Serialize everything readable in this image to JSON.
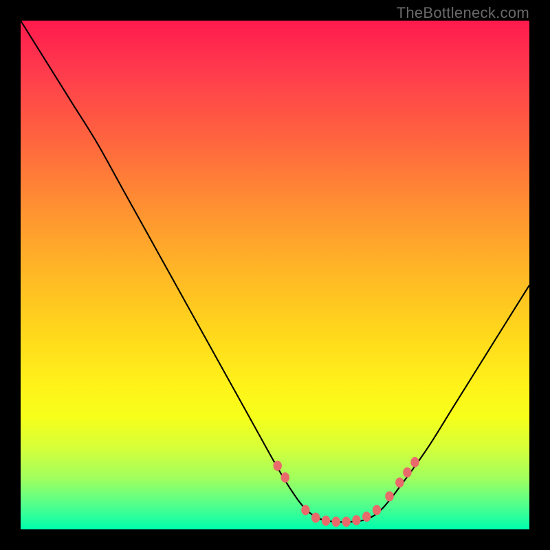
{
  "watermark": "TheBottleneck.com",
  "chart_data": {
    "type": "line",
    "title": "",
    "xlabel": "",
    "ylabel": "",
    "xlim": [
      0,
      100
    ],
    "ylim": [
      0,
      100
    ],
    "series": [
      {
        "name": "bottleneck-curve",
        "x": [
          0,
          5,
          10,
          15,
          20,
          25,
          30,
          35,
          40,
          45,
          50,
          53,
          56,
          59,
          62,
          65,
          68,
          71,
          75,
          80,
          85,
          90,
          95,
          100
        ],
        "y": [
          100,
          92,
          84,
          76,
          67,
          58,
          49,
          40,
          31,
          22,
          13,
          8,
          4,
          2,
          1.5,
          1.5,
          2,
          4,
          9,
          16,
          24,
          32,
          40,
          48
        ]
      }
    ],
    "markers": {
      "name": "highlight-dots",
      "color": "#e86a6a",
      "x": [
        50.5,
        52,
        56,
        58,
        60,
        62,
        64,
        66,
        68,
        70,
        72.5,
        74.5,
        76,
        77.5
      ],
      "y": [
        12.5,
        10.2,
        3.8,
        2.3,
        1.7,
        1.5,
        1.5,
        1.8,
        2.5,
        3.8,
        6.5,
        9.2,
        11.2,
        13.2
      ]
    }
  }
}
